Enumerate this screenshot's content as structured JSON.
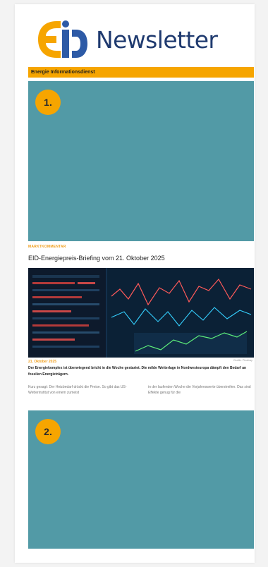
{
  "logo": {
    "word": "Newsletter",
    "mark_colors": [
      "#f6a500",
      "#2d5aa6"
    ]
  },
  "strip": {
    "label": "Energie Informationsdienst",
    "color": "#f6a500"
  },
  "teal_color": "#529aa6",
  "blocks": {
    "first_badge": "1.",
    "second_badge": "2."
  },
  "article": {
    "kicker": "MARKTKOMMENTAR",
    "headline": "EID-Energiepreis-Briefing vom 21. Oktober 2025",
    "photo_credit": "Grafik: Pixabay",
    "date": "21. Oktober 2025",
    "lead": "Der Energiekomplex ist überwiegend bricht in die Woche gestartet. Die milde Wetterlage in Nordwesteuropa dämpft den Bedarf an fossilen Energieträgern.",
    "col_left": "Kurz gesagt: Der Heizbedarf drückt die Preise. So gibt das US-Wetterinstitut von einem zumeist",
    "col_right": "in der laufenden Woche die Vorjahreswerte überstreifen. Das sind Effekte genug für die"
  }
}
